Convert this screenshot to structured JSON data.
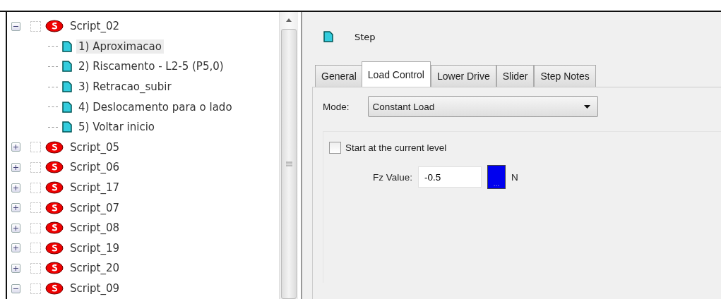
{
  "tree": [
    {
      "label": "Script_02",
      "expanded": true,
      "checked": false,
      "children": [
        {
          "label": "1)  Aproximacao",
          "selected": true
        },
        {
          "label": "2)  Riscamento - L2-5 (P5,0)",
          "selected": false
        },
        {
          "label": "3)  Retracao_subir",
          "selected": false
        },
        {
          "label": "4)  Deslocamento para o lado",
          "selected": false
        },
        {
          "label": "5)  Voltar inicio",
          "selected": false
        }
      ]
    },
    {
      "label": "Script_05",
      "expanded": false,
      "checked": false
    },
    {
      "label": "Script_06",
      "expanded": false,
      "checked": false
    },
    {
      "label": "Script_17",
      "expanded": false,
      "checked": false
    },
    {
      "label": "Script_07",
      "expanded": false,
      "checked": false
    },
    {
      "label": "Script_08",
      "expanded": false,
      "checked": false
    },
    {
      "label": "Script_19",
      "expanded": false,
      "checked": false
    },
    {
      "label": "Script_20",
      "expanded": false,
      "checked": false
    },
    {
      "label": "Script_09",
      "expanded": true,
      "checked": false
    }
  ],
  "header": {
    "title": "Step"
  },
  "tabs": [
    {
      "label": "General",
      "selected": false
    },
    {
      "label": "Load Control",
      "selected": true
    },
    {
      "label": "Lower Drive",
      "selected": false
    },
    {
      "label": "Slider",
      "selected": false
    },
    {
      "label": "Step Notes",
      "selected": false
    }
  ],
  "mode": {
    "label": "Mode:",
    "value": "Constant Load"
  },
  "start_current": {
    "label": "Start at the current level",
    "checked": false
  },
  "fz": {
    "label": "Fz Value:",
    "value": "-0.5",
    "button": "...",
    "unit": "N"
  }
}
